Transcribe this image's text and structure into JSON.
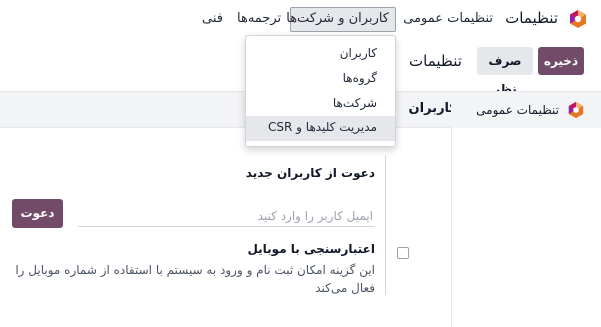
{
  "navbar": {
    "app_title": "تنظیمات",
    "menu": [
      {
        "label": "تنظیمات عمومی"
      },
      {
        "label": "کاربران و شرکت‌ها"
      },
      {
        "label": "ترجمه‌ها"
      },
      {
        "label": "فنی"
      }
    ]
  },
  "dropdown": {
    "items": [
      {
        "label": "کاربران"
      },
      {
        "label": "گروه‌ها"
      },
      {
        "label": "شرکت‌ها"
      },
      {
        "label": "مدیریت کلیدها و CSR"
      }
    ]
  },
  "control_panel": {
    "save_label": "ذخیره",
    "discard_label": "صرف نظر",
    "breadcrumb": "تنظیمات"
  },
  "sidebar": {
    "items": [
      {
        "label": "تنظیمات عمومی"
      }
    ]
  },
  "content": {
    "section_title": "کاربران",
    "invite": {
      "title": "دعوت از کاربران جدید",
      "placeholder": "ایمیل کاربر را وارد کنید",
      "button_label": "دعوت"
    },
    "mobile_auth": {
      "title": "اعتبارسنجی با موبایل",
      "description": "این گزینه امکان ثبت نام و ورود به سیستم با استفاده از شماره موبایل را فعال می‌کند",
      "checked": false
    }
  },
  "colors": {
    "primary": "#714b67",
    "header_bg": "#f3f4f6",
    "active_menu_bg": "#e5e7eb"
  }
}
